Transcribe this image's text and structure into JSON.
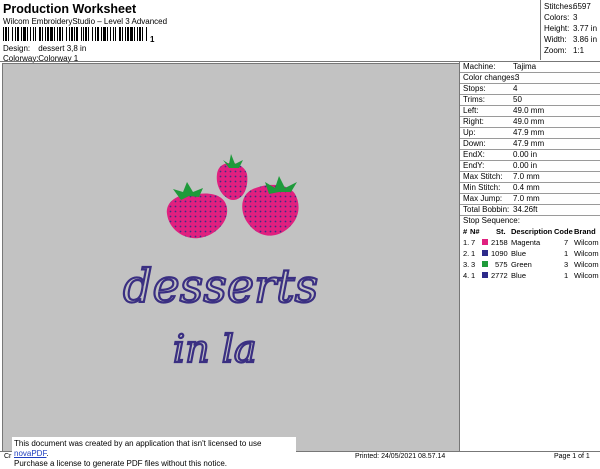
{
  "header": {
    "title": "Production Worksheet",
    "subtitle": "Wilcom EmbroideryStudio – Level 3 Advanced",
    "barcode_suffix": "1",
    "design_label": "Design:",
    "design_value": "dessert 3,8 in",
    "colorway_label": "Colorway:",
    "colorway_value": "Colorway 1"
  },
  "summary": [
    {
      "label": "Stitches:",
      "value": "6597"
    },
    {
      "label": "Colors:",
      "value": "3"
    },
    {
      "label": "Height:",
      "value": "3.77 in"
    },
    {
      "label": "Width:",
      "value": "3.86 in"
    },
    {
      "label": "Zoom:",
      "value": "1:1"
    }
  ],
  "design_text": {
    "line1": "desserts",
    "line2": "in la"
  },
  "machine": [
    {
      "label": "Machine:",
      "value": "Tajima"
    },
    {
      "label": "Color changes:",
      "value": "3"
    },
    {
      "label": "Stops:",
      "value": "4"
    },
    {
      "label": "Trims:",
      "value": "50"
    },
    {
      "label": "Left:",
      "value": "49.0 mm"
    },
    {
      "label": "Right:",
      "value": "49.0 mm"
    },
    {
      "label": "Up:",
      "value": "47.9 mm"
    },
    {
      "label": "Down:",
      "value": "47.9 mm"
    },
    {
      "label": "EndX:",
      "value": "0.00 in"
    },
    {
      "label": "EndY:",
      "value": "0.00 in"
    },
    {
      "label": "Max Stitch:",
      "value": "7.0 mm"
    },
    {
      "label": "Min Stitch:",
      "value": "0.4 mm"
    },
    {
      "label": "Max Jump:",
      "value": "7.0 mm"
    },
    {
      "label": "Total Bobbin:",
      "value": "34.26ft"
    }
  ],
  "stop_sequence": {
    "title": "Stop Sequence:",
    "headers": {
      "num": "#",
      "n": "N#",
      "st": "St.",
      "desc": "Description",
      "code": "Code",
      "brand": "Brand"
    },
    "rows": [
      {
        "num": "1.",
        "n": "7",
        "color": "#e0207f",
        "st": "2158",
        "desc": "Magenta",
        "code": "7",
        "brand": "Wilcom"
      },
      {
        "num": "2.",
        "n": "1",
        "color": "#2e2a8a",
        "st": "1090",
        "desc": "Blue",
        "code": "1",
        "brand": "Wilcom"
      },
      {
        "num": "3.",
        "n": "3",
        "color": "#1e9a3a",
        "st": "575",
        "desc": "Green",
        "code": "3",
        "brand": "Wilcom"
      },
      {
        "num": "4.",
        "n": "1",
        "color": "#2e2a8a",
        "st": "2772",
        "desc": "Blue",
        "code": "1",
        "brand": "Wilcom"
      }
    ]
  },
  "notice": {
    "line1_prefix": "This document was created by an application that isn't licensed to use ",
    "link": "novaPDF",
    "line1_suffix": ".",
    "line2": "Purchase a license to generate PDF files without this notice."
  },
  "footer": {
    "left": "Cr",
    "printed": "Printed: 24/05/2021 08.57.14",
    "page": "Page 1 of 1"
  },
  "colors": {
    "magenta": "#e0207f",
    "blue": "#3a2f82",
    "green": "#1e9a3a",
    "background": "#c2c2c2"
  }
}
